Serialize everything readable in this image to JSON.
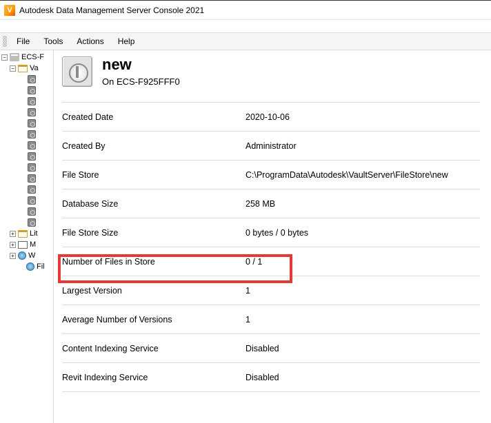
{
  "window": {
    "title": "Autodesk Data Management Server Console 2021",
    "app_icon_letter": "V"
  },
  "menu": {
    "file": "File",
    "tools": "Tools",
    "actions": "Actions",
    "help": "Help"
  },
  "tree": {
    "root": "ECS-F",
    "vaults_folder": "Va",
    "libraries": "Lit",
    "management": "M",
    "workgroups": "W",
    "filestores": "Fil"
  },
  "header": {
    "title": "new",
    "subtitle": "On ECS-F925FFF0"
  },
  "props": {
    "created_date": {
      "label": "Created Date",
      "value": "2020-10-06"
    },
    "created_by": {
      "label": "Created By",
      "value": "Administrator"
    },
    "file_store": {
      "label": "File Store",
      "value": "C:\\ProgramData\\Autodesk\\VaultServer\\FileStore\\new"
    },
    "database_size": {
      "label": "Database Size",
      "value": "258 MB"
    },
    "file_store_size": {
      "label": "File Store Size",
      "value": "0 bytes / 0 bytes"
    },
    "num_files": {
      "label": "Number of Files in Store",
      "value": "0 / 1"
    },
    "largest_version": {
      "label": "Largest Version",
      "value": "1"
    },
    "avg_versions": {
      "label": "Average Number of Versions",
      "value": "1"
    },
    "content_indexing": {
      "label": "Content Indexing Service",
      "value": "Disabled"
    },
    "revit_indexing": {
      "label": "Revit Indexing Service",
      "value": "Disabled"
    }
  },
  "expander": {
    "plus": "+",
    "minus": "−"
  }
}
